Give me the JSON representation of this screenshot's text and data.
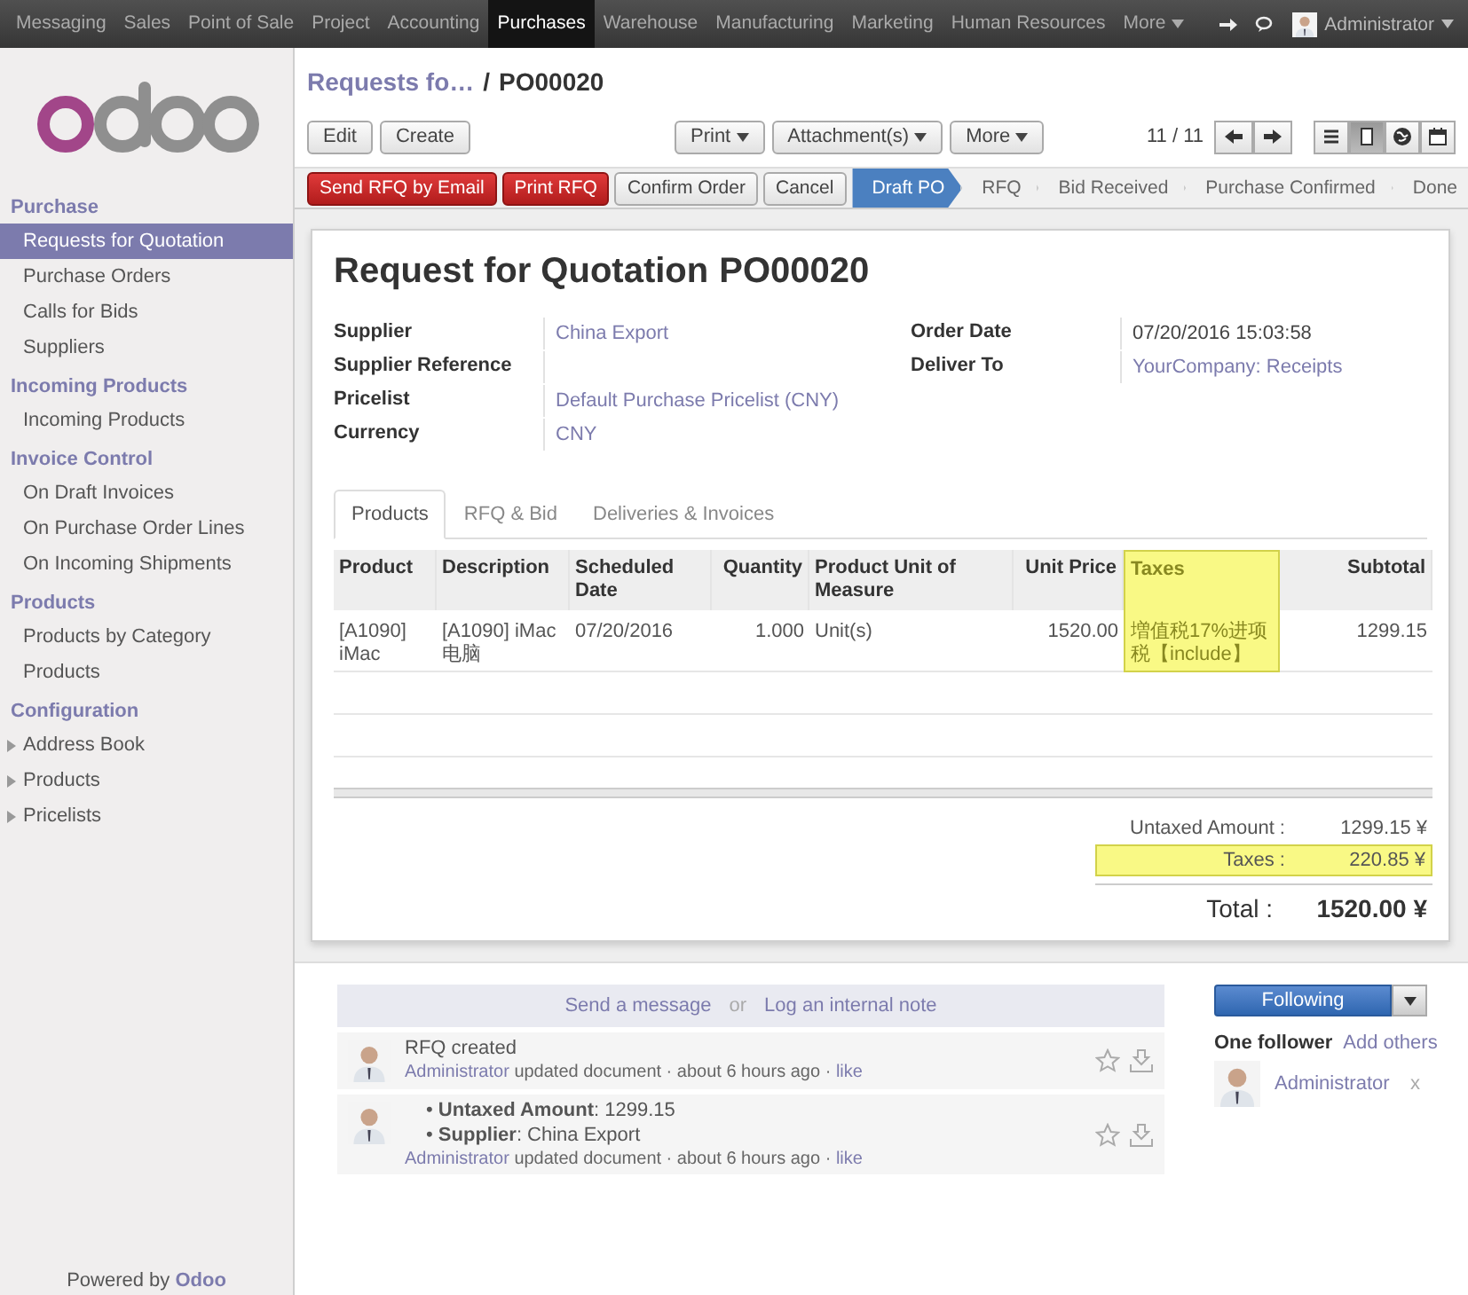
{
  "top_menu": {
    "items": [
      {
        "label": "Messaging",
        "selected": false
      },
      {
        "label": "Sales",
        "selected": false
      },
      {
        "label": "Point of Sale",
        "selected": false
      },
      {
        "label": "Project",
        "selected": false
      },
      {
        "label": "Accounting",
        "selected": false
      },
      {
        "label": "Purchases",
        "selected": true
      },
      {
        "label": "Warehouse",
        "selected": false
      },
      {
        "label": "Manufacturing",
        "selected": false
      },
      {
        "label": "Marketing",
        "selected": false
      },
      {
        "label": "Human Resources",
        "selected": false
      }
    ],
    "more": "More",
    "user": "Administrator"
  },
  "sidebar": {
    "sections": [
      {
        "title": "Purchase",
        "items": [
          {
            "label": "Requests for Quotation",
            "selected": true,
            "kind": "leaf"
          },
          {
            "label": "Purchase Orders",
            "selected": false,
            "kind": "leaf"
          },
          {
            "label": "Calls for Bids",
            "selected": false,
            "kind": "leaf"
          },
          {
            "label": "Suppliers",
            "selected": false,
            "kind": "leaf"
          }
        ]
      },
      {
        "title": "Incoming Products",
        "items": [
          {
            "label": "Incoming Products",
            "selected": false,
            "kind": "leaf"
          }
        ]
      },
      {
        "title": "Invoice Control",
        "items": [
          {
            "label": "On Draft Invoices",
            "selected": false,
            "kind": "leaf"
          },
          {
            "label": "On Purchase Order Lines",
            "selected": false,
            "kind": "leaf"
          },
          {
            "label": "On Incoming Shipments",
            "selected": false,
            "kind": "leaf"
          }
        ]
      },
      {
        "title": "Products",
        "items": [
          {
            "label": "Products by Category",
            "selected": false,
            "kind": "leaf"
          },
          {
            "label": "Products",
            "selected": false,
            "kind": "leaf"
          }
        ]
      },
      {
        "title": "Configuration",
        "items": [
          {
            "label": "Address Book",
            "selected": false,
            "kind": "folder"
          },
          {
            "label": "Products",
            "selected": false,
            "kind": "folder"
          },
          {
            "label": "Pricelists",
            "selected": false,
            "kind": "folder"
          }
        ]
      }
    ],
    "footer_text": "Powered by",
    "footer_brand": "Odoo"
  },
  "breadcrumb": {
    "parent": "Requests fo…",
    "separator": "/",
    "current": "PO00020"
  },
  "toolbar": {
    "buttons": [
      "Edit",
      "Create"
    ],
    "menus": [
      "Print",
      "Attachment(s)",
      "More"
    ],
    "pager": "11 / 11",
    "views": [
      {
        "kind": "list",
        "selected": false
      },
      {
        "kind": "form",
        "selected": true
      },
      {
        "kind": "map",
        "selected": false
      },
      {
        "kind": "calendar",
        "selected": false
      }
    ]
  },
  "actions": [
    {
      "label": "Send RFQ by Email",
      "kind": "primary"
    },
    {
      "label": "Print RFQ",
      "kind": "primary"
    },
    {
      "label": "Confirm Order",
      "kind": "default"
    },
    {
      "label": "Cancel",
      "kind": "default"
    }
  ],
  "stages": [
    {
      "label": "Draft PO",
      "selected": true
    },
    {
      "label": "RFQ",
      "selected": false
    },
    {
      "label": "Bid Received",
      "selected": false
    },
    {
      "label": "Purchase Confirmed",
      "selected": false
    },
    {
      "label": "Done",
      "selected": false
    }
  ],
  "form": {
    "title": "Request for Quotation",
    "number": "PO00020",
    "left_fields": [
      {
        "label": "Supplier",
        "value": "China Export",
        "kind": "link"
      },
      {
        "label": "Supplier Reference",
        "kind": "empty"
      },
      {
        "label": "Pricelist",
        "value": "Default Purchase Pricelist (CNY)",
        "kind": "link"
      },
      {
        "label": "Currency",
        "value": "CNY",
        "kind": "link"
      }
    ],
    "right_fields": [
      {
        "label": "Order Date",
        "value": "07/20/2016 15:03:58",
        "kind": "text"
      },
      {
        "label": "Deliver To",
        "value": "YourCompany: Receipts",
        "kind": "link"
      }
    ],
    "tabs": [
      {
        "label": "Products",
        "selected": true
      },
      {
        "label": "RFQ & Bid",
        "selected": false
      },
      {
        "label": "Deliveries & Invoices",
        "selected": false
      }
    ],
    "table": {
      "columns": [
        {
          "label": "Product",
          "kind": "text",
          "highlighted": false
        },
        {
          "label": "Description",
          "kind": "text",
          "highlighted": false
        },
        {
          "label": "Scheduled Date",
          "kind": "text",
          "highlighted": false
        },
        {
          "label": "Quantity",
          "kind": "number",
          "highlighted": false
        },
        {
          "label": "Product Unit of Measure",
          "kind": "text",
          "highlighted": false
        },
        {
          "label": "Unit Price",
          "kind": "number",
          "highlighted": false
        },
        {
          "label": "Taxes",
          "kind": "text",
          "highlighted": true
        },
        {
          "label": "Subtotal",
          "kind": "number",
          "highlighted": false
        }
      ],
      "rows": [
        {
          "cells": [
            "[A1090] iMac",
            "[A1090] iMac 电脑",
            "07/20/2016",
            "1.000",
            "Unit(s)",
            "1520.00",
            "増值税17%进项税【include】",
            "1299.15"
          ]
        }
      ]
    },
    "totals": [
      {
        "label": "Untaxed Amount :",
        "value": "1299.15 ¥",
        "highlighted": false
      },
      {
        "label": "Taxes :",
        "value": "220.85 ¥",
        "highlighted": true
      }
    ],
    "total": {
      "label": "Total :",
      "value": "1520.00 ¥"
    }
  },
  "chatter": {
    "send": "Send a message",
    "or": "or",
    "log": "Log an internal note",
    "messages": [
      {
        "kind": "text",
        "body": "RFQ created",
        "author": "Administrator",
        "meta": "updated document · about 6 hours ago ·",
        "like": "like"
      },
      {
        "kind": "changes",
        "changes": [
          "• **Untaxed Amount**: 1299.15",
          "• **Supplier**: China Export"
        ],
        "author": "Administrator",
        "meta": "updated document · about 6 hours ago ·",
        "like": "like"
      }
    ],
    "follow_button": "Following",
    "followers_label": "One follower",
    "add_others": "Add others",
    "followers": [
      {
        "name": "Administrator",
        "remove": "x"
      }
    ]
  }
}
